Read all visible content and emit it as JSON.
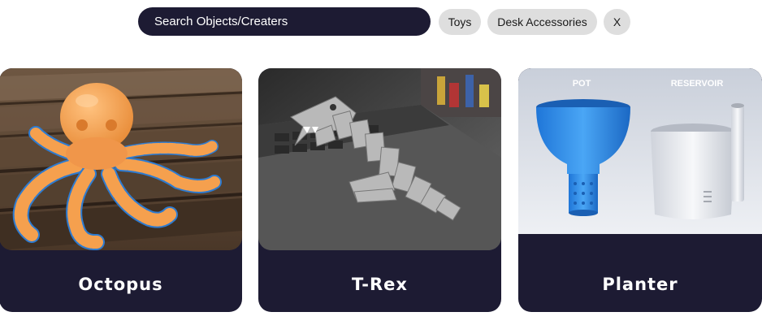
{
  "search": {
    "placeholder": "Search Objects/Creaters"
  },
  "filters": {
    "chips": [
      {
        "label": "Toys"
      },
      {
        "label": "Desk Accessories"
      }
    ],
    "clear_label": "X"
  },
  "cards": [
    {
      "title": "Octopus",
      "image": "octopus-photo"
    },
    {
      "title": "T-Rex",
      "image": "t-rex-photo"
    },
    {
      "title": "Planter",
      "image": "planter-photo",
      "image_labels": {
        "left": "POT",
        "right": "RESERVOIR"
      }
    }
  ],
  "colors": {
    "dark": "#1d1b33",
    "chip": "#dedede",
    "octopus_orange": "#f5a04e",
    "planter_blue": "#2f8ee8"
  }
}
